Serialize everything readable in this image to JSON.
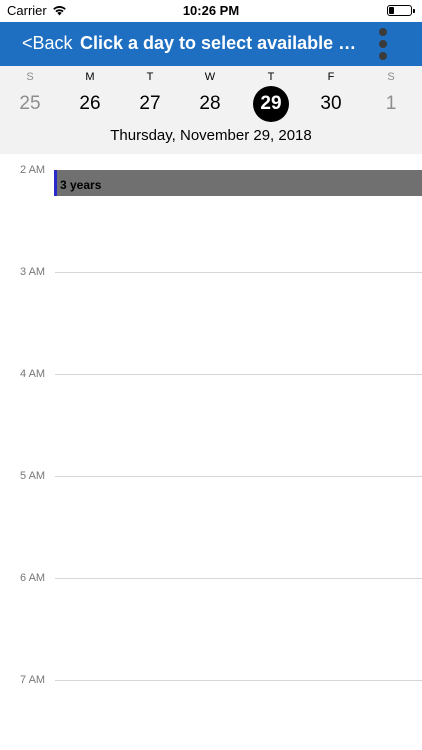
{
  "status_bar": {
    "carrier": "Carrier",
    "time": "10:26 PM"
  },
  "nav": {
    "back_label": "<Back",
    "title": "Click a day to select available ap..."
  },
  "week": {
    "days": [
      {
        "dow": "S",
        "date": "25",
        "muted": true
      },
      {
        "dow": "M",
        "date": "26",
        "muted": false
      },
      {
        "dow": "T",
        "date": "27",
        "muted": false
      },
      {
        "dow": "W",
        "date": "28",
        "muted": false
      },
      {
        "dow": "T",
        "date": "29",
        "muted": false,
        "selected": true
      },
      {
        "dow": "F",
        "date": "30",
        "muted": false
      },
      {
        "dow": "S",
        "date": "1",
        "muted": true
      }
    ],
    "selected_date_label": "Thursday, November 29, 2018"
  },
  "timeline": {
    "hours": [
      "2 AM",
      "3 AM",
      "4 AM",
      "5 AM",
      "6 AM",
      "7 AM"
    ],
    "events": [
      {
        "title": "3 years",
        "color": "#707070",
        "accent": "#2a2acc"
      }
    ]
  },
  "colors": {
    "nav_background": "#1e6fc1",
    "strip_background": "#f2f2f2",
    "selected_day": "#000000"
  }
}
